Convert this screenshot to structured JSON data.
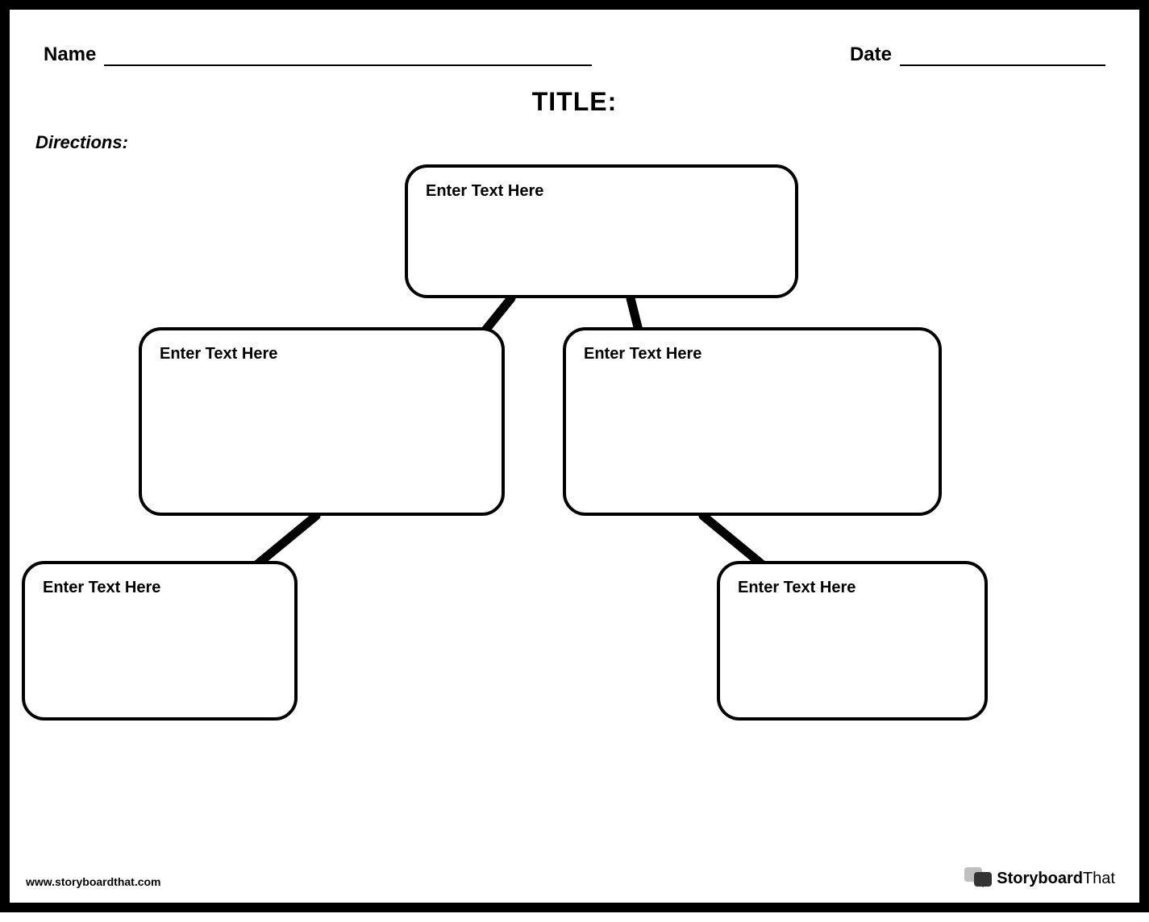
{
  "header": {
    "name_label": "Name",
    "date_label": "Date"
  },
  "title": "TITLE:",
  "directions_label": "Directions:",
  "boxes": {
    "top_placeholder": "Enter Text Here",
    "left2_placeholder": "Enter Text Here",
    "right2_placeholder": "Enter Text Here",
    "left3_placeholder": "Enter Text Here",
    "right3_placeholder": "Enter Text Here"
  },
  "footer": {
    "url": "www.storyboardthat.com",
    "logo_bold": "Storyboard",
    "logo_light": "That"
  }
}
